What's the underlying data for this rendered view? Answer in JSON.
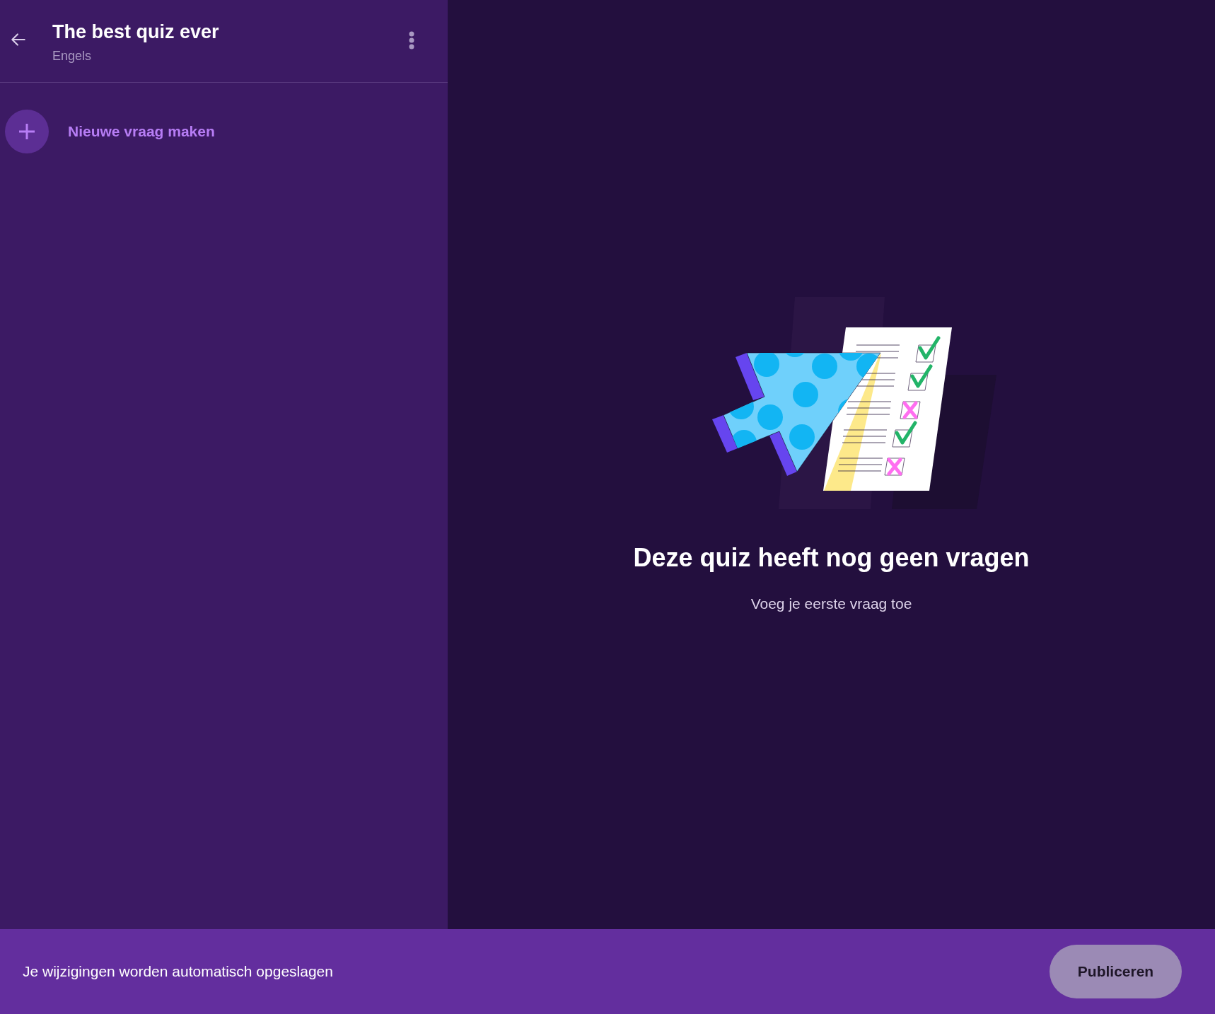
{
  "sidebar": {
    "title": "The best quiz ever",
    "subtitle": "Engels",
    "new_question": {
      "label": "Nieuwe vraag maken"
    }
  },
  "empty_state": {
    "heading": "Deze quiz heeft nog geen vragen",
    "message": "Voeg je eerste vraag toe"
  },
  "footer": {
    "status": "Je wijzigingen worden automatisch opgeslagen",
    "publish_button": {
      "label": "Publiceren",
      "disabled": true
    }
  }
}
